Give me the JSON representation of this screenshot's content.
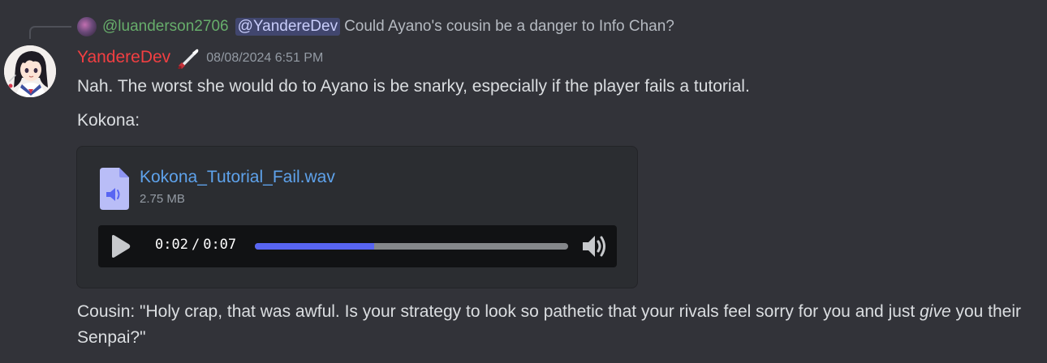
{
  "reply": {
    "username": "@luanderson2706",
    "mention": "@YandereDev",
    "text": "Could Ayano's cousin be a danger to Info Chan?"
  },
  "message": {
    "author": "YandereDev",
    "author_color": "#f23f42",
    "role_icon": "knife-icon",
    "timestamp": "08/08/2024 6:51 PM",
    "line1": "Nah. The worst she would do to Ayano is be snarky, especially if the player fails a tutorial.",
    "line2": "Kokona:",
    "cousin_part1": "Cousin: \"Holy crap, that was awful. Is your strategy to look so pathetic that your rivals feel sorry for you and just ",
    "cousin_emphasis": "give",
    "cousin_part2": " you their Senpai?\""
  },
  "attachment": {
    "file_name": "Kokona_Tutorial_Fail.wav",
    "file_size": "2.75 MB",
    "icon": "audio-file-icon",
    "player": {
      "current_time": "0:02",
      "separator": "/",
      "duration": "0:07",
      "progress_fraction": 0.38,
      "play_icon": "play-icon",
      "volume_icon": "volume-icon"
    }
  },
  "colors": {
    "background": "#323339",
    "link": "#5ea2eb",
    "progress": "#5865f2",
    "reply_user": "#67ad6b",
    "mention_bg": "#41466e"
  }
}
